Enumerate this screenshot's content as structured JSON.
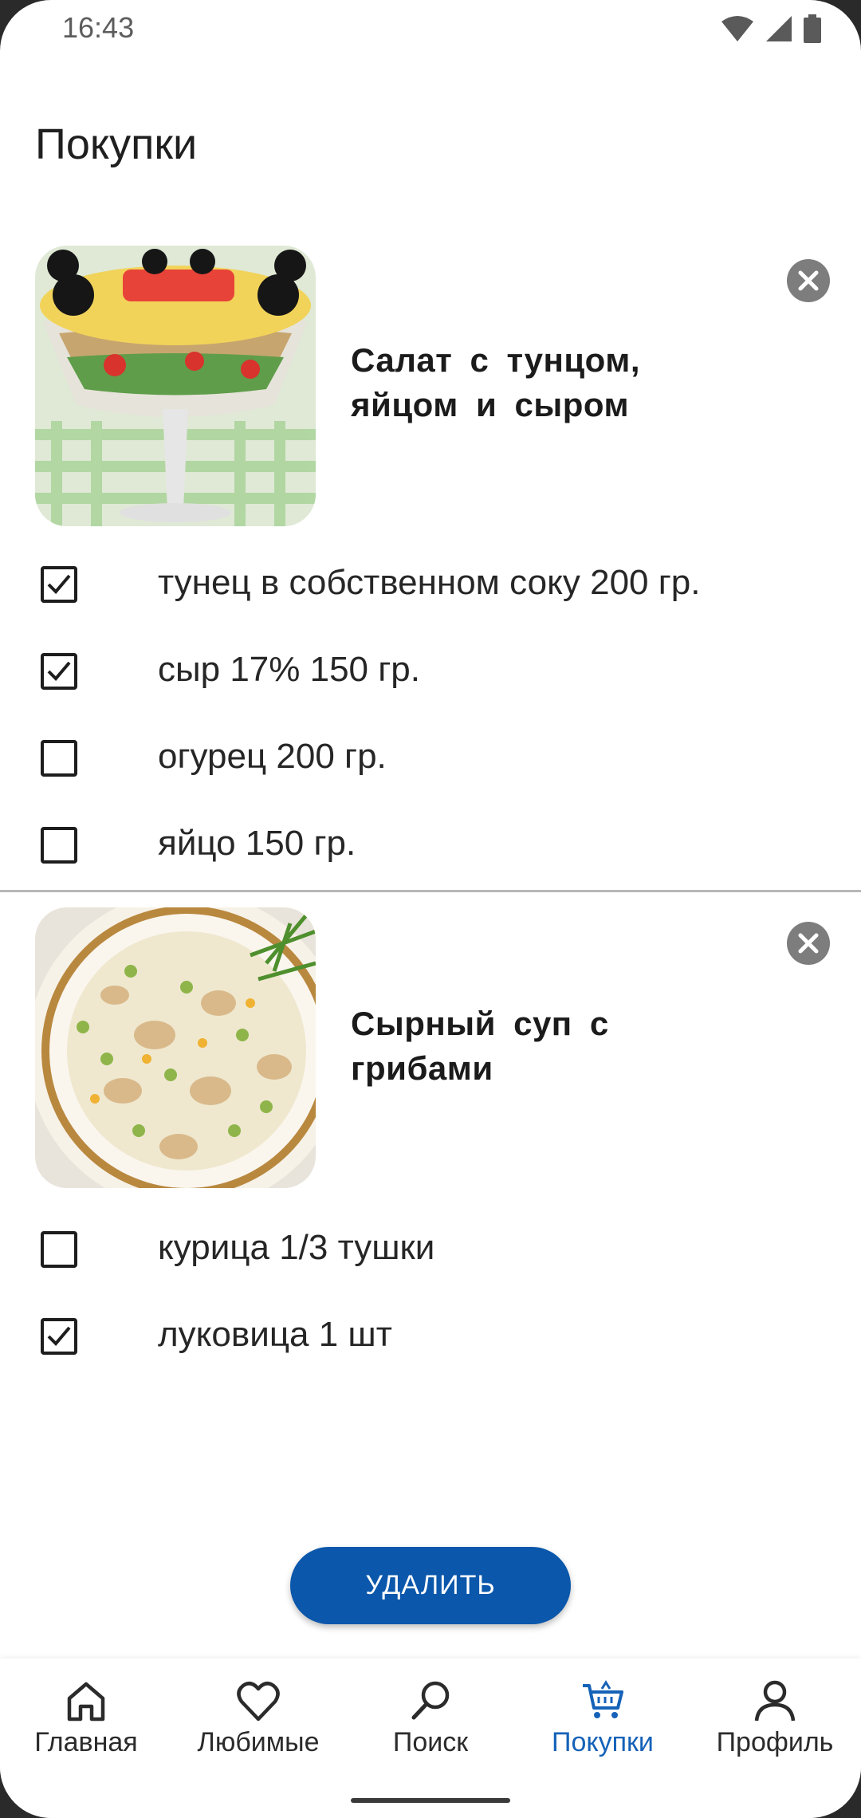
{
  "status_bar": {
    "time": "16:43"
  },
  "page": {
    "title": "Покупки"
  },
  "recipes": [
    {
      "title": "Салат с тунцом, яйцом и сыром",
      "ingredients": [
        {
          "label": "тунец в собственном соку 200 гр.",
          "checked": true
        },
        {
          "label": "сыр 17% 150 гр.",
          "checked": true
        },
        {
          "label": "огурец 200 гр.",
          "checked": false
        },
        {
          "label": "яйцо 150 гр.",
          "checked": false
        }
      ]
    },
    {
      "title": "Сырный суп с грибами",
      "ingredients": [
        {
          "label": "курица 1/3 тушки",
          "checked": false
        },
        {
          "label": "луковица 1 шт",
          "checked": true
        }
      ]
    }
  ],
  "actions": {
    "delete_label": "УДАЛИТЬ"
  },
  "bottom_nav": {
    "items": [
      {
        "label": "Главная",
        "icon": "home-icon",
        "active": false
      },
      {
        "label": "Любимые",
        "icon": "heart-icon",
        "active": false
      },
      {
        "label": "Поиск",
        "icon": "search-icon",
        "active": false
      },
      {
        "label": "Покупки",
        "icon": "cart-icon",
        "active": true
      },
      {
        "label": "Профиль",
        "icon": "profile-icon",
        "active": false
      }
    ],
    "active_color": "#1562b8"
  },
  "colors": {
    "accent": "#0a57ab"
  }
}
